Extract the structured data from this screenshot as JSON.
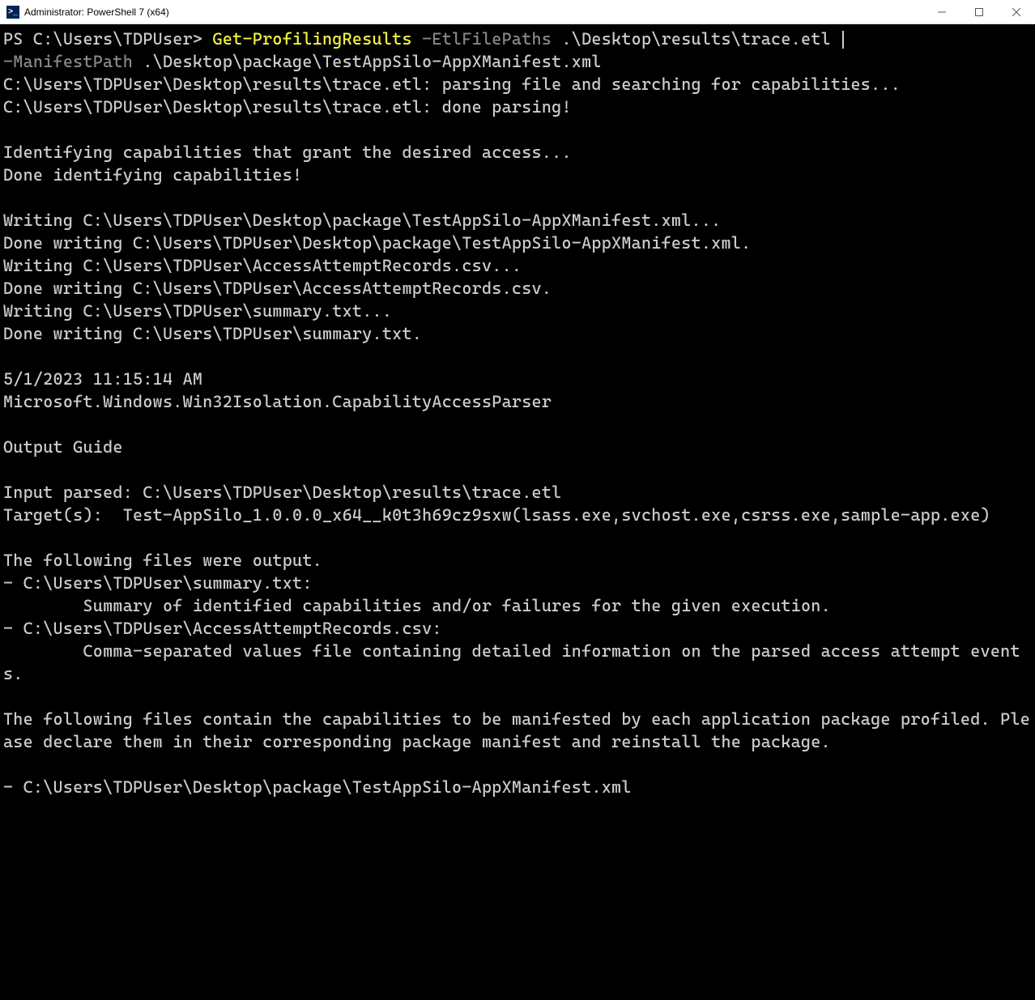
{
  "titlebar": {
    "icon_text": ">_",
    "title": "Administrator: PowerShell 7 (x64)"
  },
  "terminal": {
    "prompt": "PS C:\\Users\\TDPUser> ",
    "cmdlet": "Get-ProfilingResults ",
    "param1": "-EtlFilePaths ",
    "arg1": ".\\Desktop\\results\\trace.etl ",
    "param2": "-ManifestPath ",
    "arg2": ".\\Desktop\\package\\TestAppSilo-AppXManifest.xml",
    "lines": [
      "C:\\Users\\TDPUser\\Desktop\\results\\trace.etl: parsing file and searching for capabilities...",
      "C:\\Users\\TDPUser\\Desktop\\results\\trace.etl: done parsing!",
      "",
      "Identifying capabilities that grant the desired access...",
      "Done identifying capabilities!",
      "",
      "Writing C:\\Users\\TDPUser\\Desktop\\package\\TestAppSilo-AppXManifest.xml...",
      "Done writing C:\\Users\\TDPUser\\Desktop\\package\\TestAppSilo-AppXManifest.xml.",
      "Writing C:\\Users\\TDPUser\\AccessAttemptRecords.csv...",
      "Done writing C:\\Users\\TDPUser\\AccessAttemptRecords.csv.",
      "Writing C:\\Users\\TDPUser\\summary.txt...",
      "Done writing C:\\Users\\TDPUser\\summary.txt.",
      "",
      "5/1/2023 11:15:14 AM",
      "Microsoft.Windows.Win32Isolation.CapabilityAccessParser",
      "",
      "Output Guide",
      "",
      "Input parsed: C:\\Users\\TDPUser\\Desktop\\results\\trace.etl",
      "Target(s):  Test-AppSilo_1.0.0.0_x64__k0t3h69cz9sxw(lsass.exe,svchost.exe,csrss.exe,sample-app.exe)",
      "",
      "The following files were output.",
      "- C:\\Users\\TDPUser\\summary.txt:",
      "        Summary of identified capabilities and/or failures for the given execution.",
      "- C:\\Users\\TDPUser\\AccessAttemptRecords.csv:",
      "        Comma-separated values file containing detailed information on the parsed access attempt events.",
      "",
      "The following files contain the capabilities to be manifested by each application package profiled. Please declare them in their corresponding package manifest and reinstall the package.",
      "",
      "- C:\\Users\\TDPUser\\Desktop\\package\\TestAppSilo-AppXManifest.xml"
    ]
  }
}
